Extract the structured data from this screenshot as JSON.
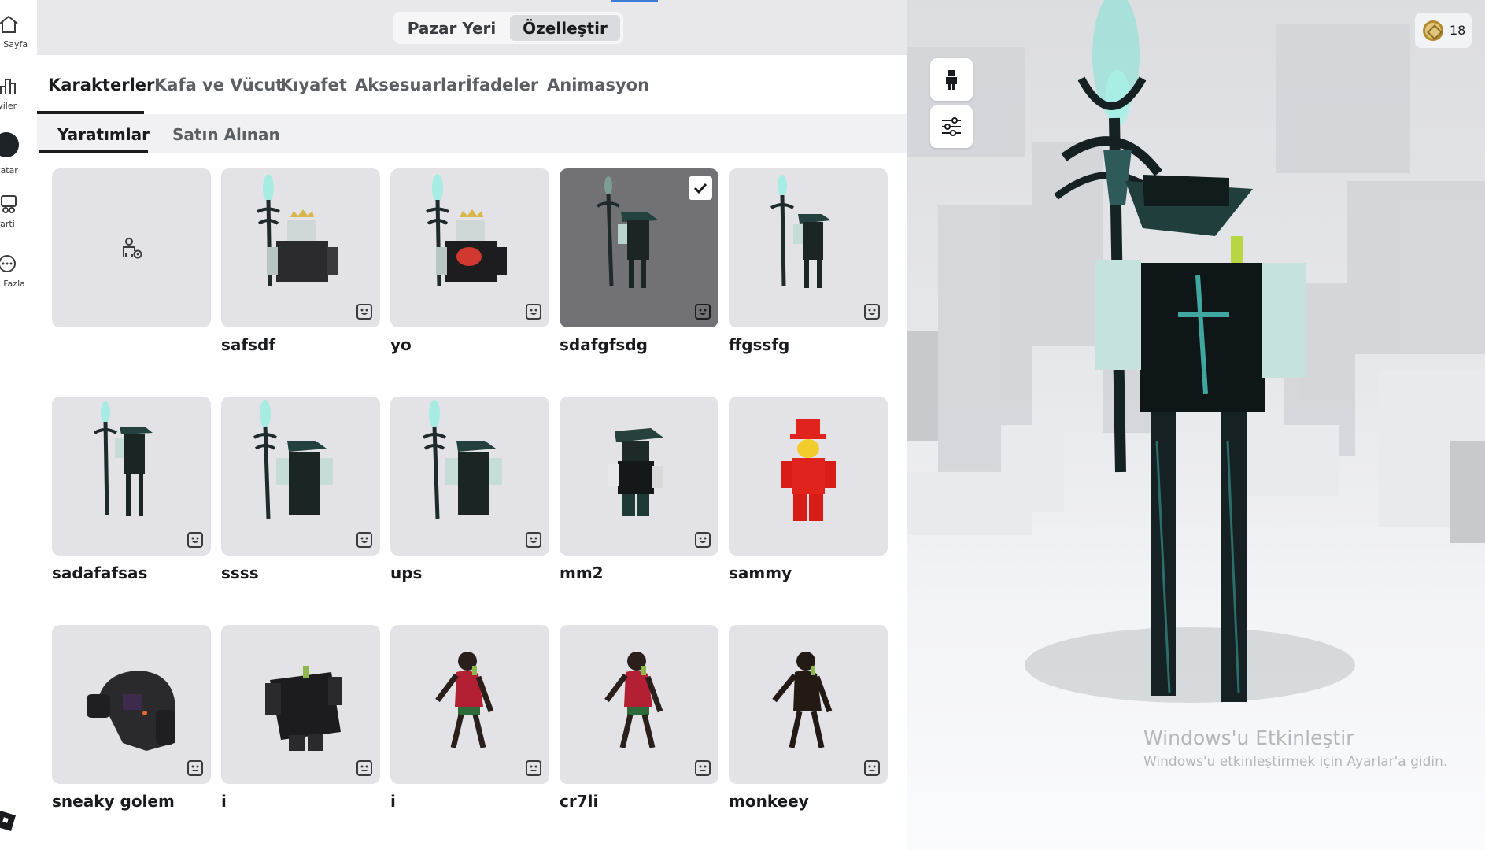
{
  "sidebar": {
    "items": [
      {
        "label": "a Sayfa",
        "icon": "home-icon"
      },
      {
        "label": "İyiler",
        "icon": "chart-icon"
      },
      {
        "label": "vatar",
        "icon": "avatar-icon"
      },
      {
        "label": "Parti",
        "icon": "party-icon"
      },
      {
        "label": "a Fazla",
        "icon": "more-icon"
      }
    ]
  },
  "topnav": {
    "marketplace": "Pazar Yeri",
    "customize": "Özelleştir"
  },
  "tabs": [
    "Karakterler",
    "Kafa ve Vücut",
    "Kıyafet",
    "Aksesuarlar",
    "İfadeler",
    "Animasyon"
  ],
  "subtabs": [
    "Yaratımlar",
    "Satın Alınan"
  ],
  "characters": [
    {
      "name": ""
    },
    {
      "name": "safsdf"
    },
    {
      "name": "yo"
    },
    {
      "name": "sdafgfsdg"
    },
    {
      "name": "ffgssfg"
    },
    {
      "name": "sadafafsas"
    },
    {
      "name": "ssss"
    },
    {
      "name": "ups"
    },
    {
      "name": "mm2"
    },
    {
      "name": "sammy"
    },
    {
      "name": "sneaky golem"
    },
    {
      "name": "i"
    },
    {
      "name": "i"
    },
    {
      "name": "cr7li"
    },
    {
      "name": "monkeey"
    }
  ],
  "viewer": {
    "robux": "18",
    "watermark_title": "Windows'u Etkinleştir",
    "watermark_sub": "Windows'u etkinleştirmek için Ayarlar'a gidin."
  },
  "colors": {
    "accent_dark": "#1a1b1e",
    "selected_card": "#717176",
    "card_bg": "#e3e3e7",
    "teal_glow": "#7de3d6"
  }
}
